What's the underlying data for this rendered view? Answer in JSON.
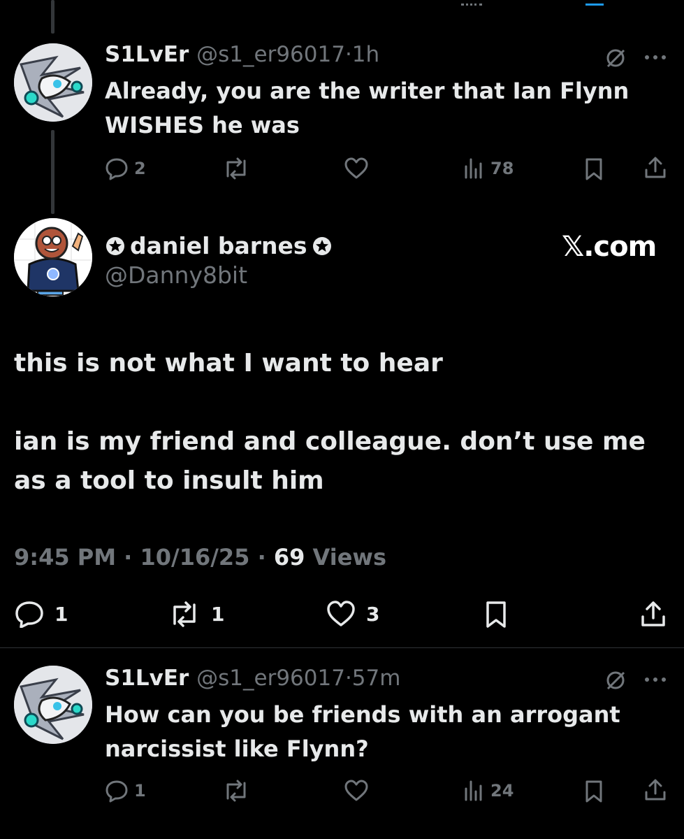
{
  "reply1": {
    "display_name": "S1LvEr",
    "handle": "@s1_er96017",
    "sep": "·",
    "time": "1h",
    "text_line1": "Already, you are the writer that Ian Flynn",
    "text_line2": "WISHES he was",
    "replies": "2",
    "retweets": "",
    "likes": "",
    "views": "78"
  },
  "main": {
    "display_name": "daniel barnes",
    "handle": "@Danny8bit",
    "watermark": "𝕏.com",
    "paragraph1": "this is not what I want to hear",
    "paragraph2_line1": "ian is my friend and colleague. don’t use me",
    "paragraph2_line2": "as a tool to insult him",
    "timestamp": "9:45 PM · 10/16/25 · ",
    "views_count": "69",
    "views_label": " Views",
    "replies": "1",
    "retweets": "1",
    "likes": "3"
  },
  "reply2": {
    "display_name": "S1LvEr",
    "handle": "@s1_er96017",
    "sep": "·",
    "time": "57m",
    "text_line1": "How can you be friends with an arrogant",
    "text_line2": "narcissist like Flynn?",
    "replies": "1",
    "views": "24"
  },
  "colors": {
    "background": "#000000",
    "text": "#e7e9ea",
    "muted": "#71767b",
    "divider": "#2f3336"
  }
}
